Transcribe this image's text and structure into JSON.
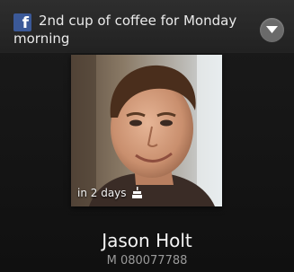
{
  "notification": {
    "source_icon": "facebook-icon",
    "status": "2nd cup of coffee for Monday morning",
    "menu_icon": "chevron-down-icon"
  },
  "contact": {
    "photo_icon": "contact-photo",
    "birthday_text": "in 2 days",
    "birthday_icon": "cake-icon",
    "name": "Jason Holt",
    "phone": "M 080077788"
  },
  "colors": {
    "background": "#131313",
    "facebook_blue": "#3b5998",
    "text_primary": "#f4f4f4",
    "text_secondary": "#9a9a9a"
  }
}
